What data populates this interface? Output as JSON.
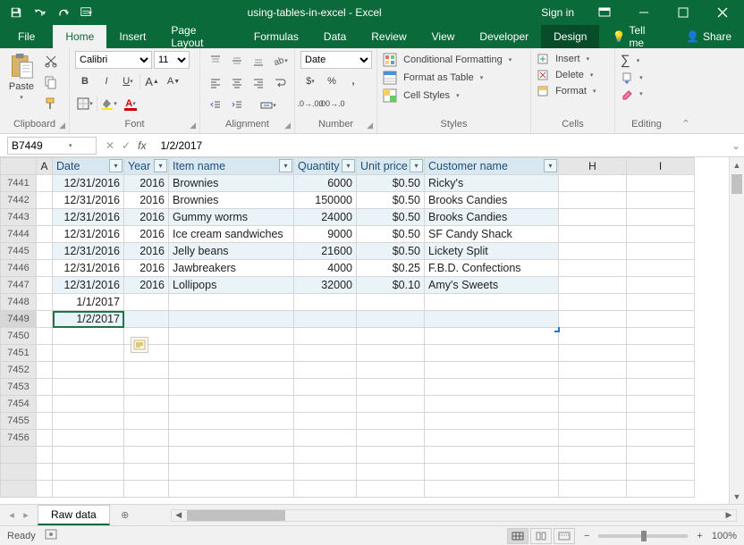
{
  "titlebar": {
    "title": "using-tables-in-excel - Excel",
    "sign_in": "Sign in"
  },
  "tabs": {
    "file": "File",
    "home": "Home",
    "insert": "Insert",
    "page_layout": "Page Layout",
    "formulas": "Formulas",
    "data": "Data",
    "review": "Review",
    "view": "View",
    "developer": "Developer",
    "design": "Design",
    "tell_me": "Tell me",
    "share": "Share"
  },
  "ribbon": {
    "clipboard": {
      "label": "Clipboard",
      "paste": "Paste"
    },
    "font": {
      "label": "Font",
      "name": "Calibri",
      "size": "11"
    },
    "alignment": {
      "label": "Alignment"
    },
    "number": {
      "label": "Number",
      "format": "Date"
    },
    "styles": {
      "label": "Styles",
      "cond": "Conditional Formatting",
      "table": "Format as Table",
      "cell": "Cell Styles"
    },
    "cells": {
      "label": "Cells",
      "insert": "Insert",
      "delete": "Delete",
      "format": "Format"
    },
    "editing": {
      "label": "Editing"
    }
  },
  "formula_bar": {
    "cell_ref": "B7449",
    "value": "1/2/2017"
  },
  "columns": [
    "A",
    "Date",
    "Year",
    "Item name",
    "Quantity",
    "Unit price",
    "Customer name",
    "H",
    "I"
  ],
  "table_headers": [
    "Date",
    "Year",
    "Item name",
    "Quantity",
    "Unit price",
    "Customer name"
  ],
  "row_numbers": [
    "7441",
    "7442",
    "7443",
    "7444",
    "7445",
    "7446",
    "7447",
    "7448",
    "7449",
    "7450",
    "7451",
    "7452",
    "7453",
    "7454",
    "7455",
    "7456"
  ],
  "rows": [
    {
      "date": "12/31/2016",
      "year": "2016",
      "item": "Brownies",
      "qty": "6000",
      "price": "$0.50",
      "cust": "Ricky's"
    },
    {
      "date": "12/31/2016",
      "year": "2016",
      "item": "Brownies",
      "qty": "150000",
      "price": "$0.50",
      "cust": "Brooks Candies"
    },
    {
      "date": "12/31/2016",
      "year": "2016",
      "item": "Gummy worms",
      "qty": "24000",
      "price": "$0.50",
      "cust": "Brooks Candies"
    },
    {
      "date": "12/31/2016",
      "year": "2016",
      "item": "Ice cream sandwiches",
      "qty": "9000",
      "price": "$0.50",
      "cust": "SF Candy Shack"
    },
    {
      "date": "12/31/2016",
      "year": "2016",
      "item": "Jelly beans",
      "qty": "21600",
      "price": "$0.50",
      "cust": "Lickety Split"
    },
    {
      "date": "12/31/2016",
      "year": "2016",
      "item": "Jawbreakers",
      "qty": "4000",
      "price": "$0.25",
      "cust": "F.B.D. Confections"
    },
    {
      "date": "12/31/2016",
      "year": "2016",
      "item": "Lollipops",
      "qty": "32000",
      "price": "$0.10",
      "cust": "Amy's Sweets"
    },
    {
      "date": "1/1/2017",
      "year": "",
      "item": "",
      "qty": "",
      "price": "",
      "cust": ""
    },
    {
      "date": "1/2/2017",
      "year": "",
      "item": "",
      "qty": "",
      "price": "",
      "cust": ""
    }
  ],
  "sheet": {
    "name": "Raw data"
  },
  "status": {
    "ready": "Ready",
    "zoom": "100%"
  },
  "col_widths": {
    "rowhdr": 40,
    "A": 18,
    "B": 80,
    "C": 50,
    "D": 140,
    "E": 70,
    "F": 76,
    "G": 150,
    "H": 76,
    "I": 76
  }
}
